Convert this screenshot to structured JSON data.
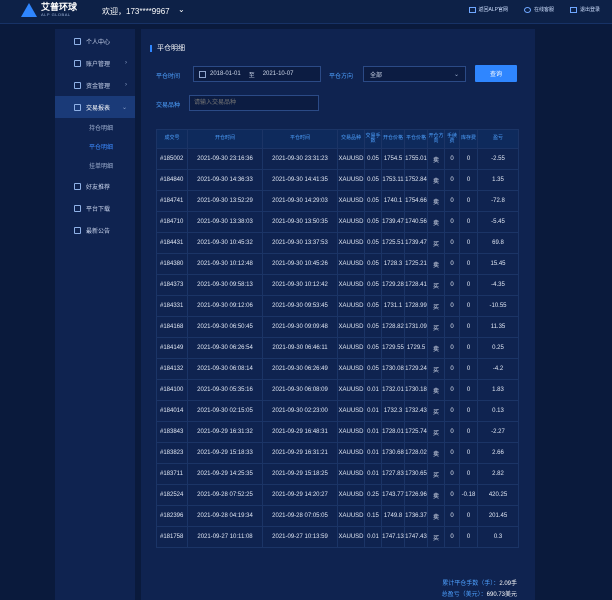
{
  "header": {
    "logo_cn": "艾普环球",
    "logo_en": "ALP GLOBAL",
    "welcome": "欢迎，173****9967",
    "caret": "⌄",
    "links": [
      "返回ALP官网",
      "在线客服",
      "退出登录"
    ]
  },
  "sidebar": {
    "items": [
      {
        "label": "个人中心",
        "icon": "home-icon"
      },
      {
        "label": "账户管理",
        "icon": "user-icon",
        "arrow": "›"
      },
      {
        "label": "资金管理",
        "icon": "wallet-icon",
        "arrow": "›"
      },
      {
        "label": "交易报表",
        "icon": "report-icon",
        "arrow": "⌄"
      },
      {
        "label": "好友推荐",
        "icon": "friends-icon"
      },
      {
        "label": "平台下载",
        "icon": "download-icon"
      },
      {
        "label": "最新公告",
        "icon": "notice-icon"
      }
    ],
    "subitems": [
      "持仓明细",
      "平仓明细",
      "挂单明细"
    ]
  },
  "main": {
    "title": "平仓明细",
    "filter": {
      "time_label": "平仓时间",
      "date_from": "2018-01-01",
      "to_label": "至",
      "date_to": "2021-10-07",
      "direction_label": "平仓方向",
      "direction_value": "全部",
      "query_button": "查询",
      "symbol_label": "交易品种",
      "symbol_placeholder": "请输入交易品种"
    },
    "columns": [
      "成交号",
      "开仓时间",
      "平仓时间",
      "交易品种",
      "交易手数",
      "开仓价格",
      "平仓价格",
      "开仓方向",
      "手续费",
      "库存费",
      "盈亏"
    ],
    "rows": [
      [
        "#185002",
        "2021-09-30 23:16:36",
        "2021-09-30 23:31:23",
        "XAUUSD",
        "0.05",
        "1754.5",
        "1755.01",
        "卖",
        "0",
        "0",
        "-2.55"
      ],
      [
        "#184840",
        "2021-09-30 14:36:33",
        "2021-09-30 14:41:35",
        "XAUUSD",
        "0.05",
        "1753.11",
        "1752.84",
        "卖",
        "0",
        "0",
        "1.35"
      ],
      [
        "#184741",
        "2021-09-30 13:52:29",
        "2021-09-30 14:29:03",
        "XAUUSD",
        "0.05",
        "1740.1",
        "1754.66",
        "卖",
        "0",
        "0",
        "-72.8"
      ],
      [
        "#184710",
        "2021-09-30 13:38:03",
        "2021-09-30 13:50:35",
        "XAUUSD",
        "0.05",
        "1739.47",
        "1740.56",
        "卖",
        "0",
        "0",
        "-5.45"
      ],
      [
        "#184431",
        "2021-09-30 10:45:32",
        "2021-09-30 13:37:53",
        "XAUUSD",
        "0.05",
        "1725.51",
        "1739.47",
        "买",
        "0",
        "0",
        "69.8"
      ],
      [
        "#184380",
        "2021-09-30 10:12:48",
        "2021-09-30 10:45:26",
        "XAUUSD",
        "0.05",
        "1728.3",
        "1725.21",
        "卖",
        "0",
        "0",
        "15.45"
      ],
      [
        "#184373",
        "2021-09-30 09:58:13",
        "2021-09-30 10:12:42",
        "XAUUSD",
        "0.05",
        "1729.28",
        "1728.41",
        "买",
        "0",
        "0",
        "-4.35"
      ],
      [
        "#184331",
        "2021-09-30 09:12:06",
        "2021-09-30 09:53:45",
        "XAUUSD",
        "0.05",
        "1731.1",
        "1728.99",
        "买",
        "0",
        "0",
        "-10.55"
      ],
      [
        "#184168",
        "2021-09-30 06:50:45",
        "2021-09-30 09:09:48",
        "XAUUSD",
        "0.05",
        "1728.82",
        "1731.09",
        "买",
        "0",
        "0",
        "11.35"
      ],
      [
        "#184149",
        "2021-09-30 06:26:54",
        "2021-09-30 06:46:11",
        "XAUUSD",
        "0.05",
        "1729.55",
        "1729.5",
        "卖",
        "0",
        "0",
        "0.25"
      ],
      [
        "#184132",
        "2021-09-30 06:08:14",
        "2021-09-30 06:26:49",
        "XAUUSD",
        "0.05",
        "1730.08",
        "1729.24",
        "买",
        "0",
        "0",
        "-4.2"
      ],
      [
        "#184100",
        "2021-09-30 05:35:16",
        "2021-09-30 06:08:09",
        "XAUUSD",
        "0.01",
        "1732.01",
        "1730.18",
        "卖",
        "0",
        "0",
        "1.83"
      ],
      [
        "#184014",
        "2021-09-30 02:15:05",
        "2021-09-30 02:23:00",
        "XAUUSD",
        "0.01",
        "1732.3",
        "1732.43",
        "买",
        "0",
        "0",
        "0.13"
      ],
      [
        "#183843",
        "2021-09-29 16:31:32",
        "2021-09-29 16:48:31",
        "XAUUSD",
        "0.01",
        "1728.01",
        "1725.74",
        "买",
        "0",
        "0",
        "-2.27"
      ],
      [
        "#183823",
        "2021-09-29 15:18:33",
        "2021-09-29 16:31:21",
        "XAUUSD",
        "0.01",
        "1730.68",
        "1728.02",
        "卖",
        "0",
        "0",
        "2.66"
      ],
      [
        "#183711",
        "2021-09-29 14:25:35",
        "2021-09-29 15:18:25",
        "XAUUSD",
        "0.01",
        "1727.83",
        "1730.65",
        "买",
        "0",
        "0",
        "2.82"
      ],
      [
        "#182524",
        "2021-09-28 07:52:25",
        "2021-09-29 14:20:27",
        "XAUUSD",
        "0.25",
        "1743.77",
        "1726.96",
        "卖",
        "0",
        "-0.18",
        "420.25"
      ],
      [
        "#182396",
        "2021-09-28 04:19:34",
        "2021-09-28 07:05:05",
        "XAUUSD",
        "0.15",
        "1749.8",
        "1736.37",
        "卖",
        "0",
        "0",
        "201.45"
      ],
      [
        "#181758",
        "2021-09-27 10:11:08",
        "2021-09-27 10:13:59",
        "XAUUSD",
        "0.01",
        "1747.13",
        "1747.43",
        "买",
        "0",
        "0",
        "0.3"
      ]
    ],
    "summary": {
      "lots_label": "累计平仓手数（手）：",
      "lots_value": "2.09手",
      "profit_label": "总盈亏（美元）：",
      "profit_value": "690.73美元"
    }
  }
}
